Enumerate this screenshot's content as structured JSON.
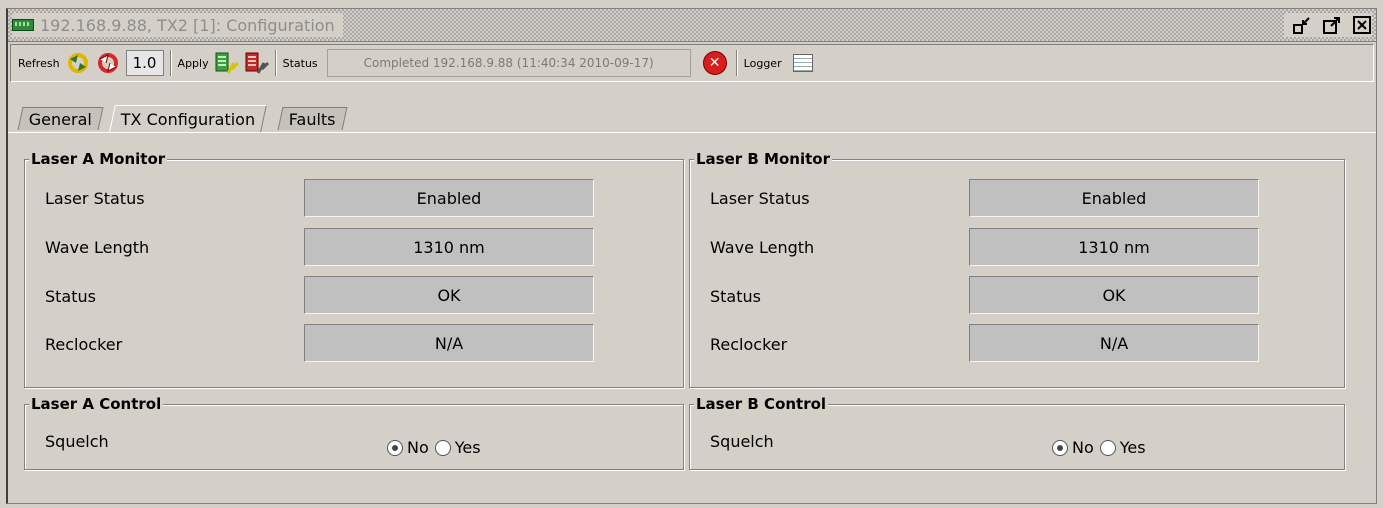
{
  "window": {
    "title": "192.168.9.88, TX2  [1]: Configuration"
  },
  "toolbar": {
    "refresh_label": "Refresh",
    "version": "1.0",
    "apply_label": "Apply",
    "status_label": "Status",
    "status_text": "Completed 192.168.9.88 (11:40:34  2010-09-17)",
    "logger_label": "Logger"
  },
  "tabs": [
    {
      "label": "General",
      "active": false
    },
    {
      "label": "TX Configuration",
      "active": true
    },
    {
      "label": "Faults",
      "active": false
    }
  ],
  "laser_a_monitor": {
    "title": "Laser A Monitor",
    "rows": [
      {
        "label": "Laser Status",
        "value": "Enabled"
      },
      {
        "label": "Wave Length",
        "value": "1310 nm"
      },
      {
        "label": "Status",
        "value": "OK"
      },
      {
        "label": "Reclocker",
        "value": "N/A"
      }
    ]
  },
  "laser_b_monitor": {
    "title": "Laser B Monitor",
    "rows": [
      {
        "label": "Laser Status",
        "value": "Enabled"
      },
      {
        "label": "Wave Length",
        "value": "1310 nm"
      },
      {
        "label": "Status",
        "value": "OK"
      },
      {
        "label": "Reclocker",
        "value": "N/A"
      }
    ]
  },
  "laser_a_control": {
    "title": "Laser A Control",
    "squelch_label": "Squelch",
    "options": [
      "No",
      "Yes"
    ],
    "selected": "No"
  },
  "laser_b_control": {
    "title": "Laser B Control",
    "squelch_label": "Squelch",
    "options": [
      "No",
      "Yes"
    ],
    "selected": "No"
  },
  "colors": {
    "background": "#d4d0c8",
    "field_background": "#c0c0c0",
    "error_icon": "#d81d1d",
    "app_icon": "#2f8a3c"
  },
  "icons": [
    "app-icon",
    "refresh-icon",
    "refresh-all-icon",
    "apply-icon",
    "apply-all-icon",
    "error-icon",
    "logger-icon",
    "minimize-icon",
    "maximize-icon",
    "close-icon"
  ]
}
